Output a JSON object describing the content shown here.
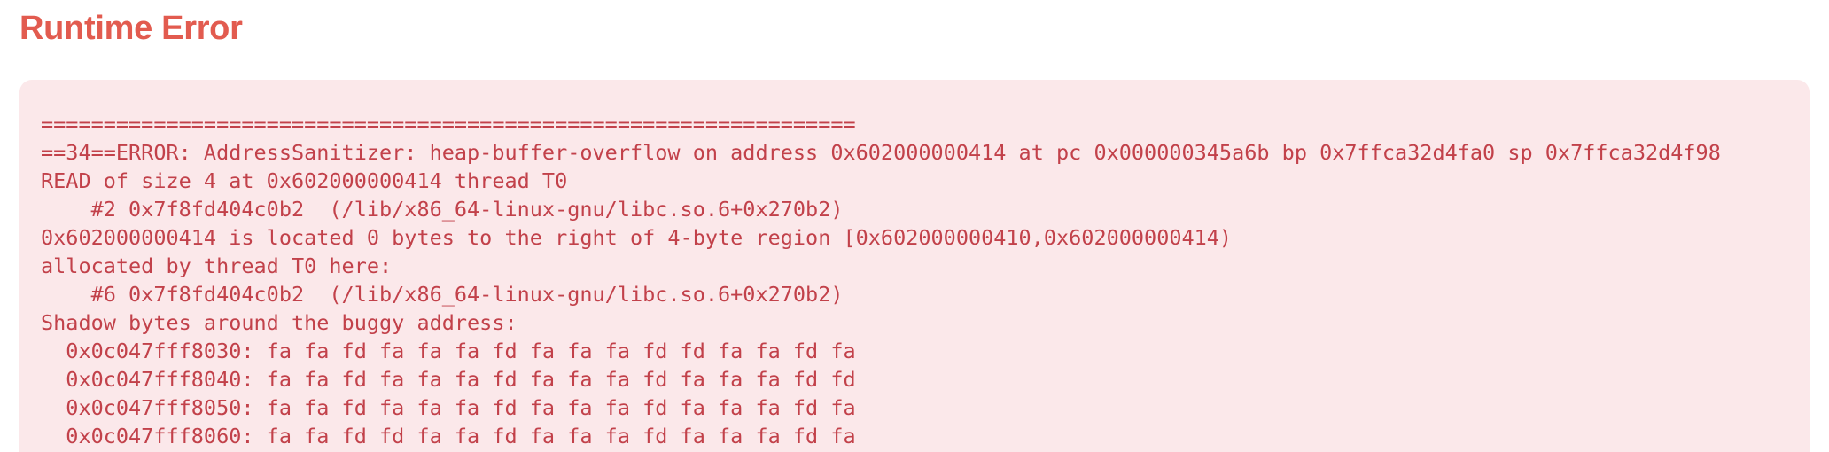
{
  "header": {
    "title": "Runtime Error"
  },
  "error": {
    "lines": [
      "=================================================================",
      "==34==ERROR: AddressSanitizer: heap-buffer-overflow on address 0x602000000414 at pc 0x000000345a6b bp 0x7ffca32d4fa0 sp 0x7ffca32d4f98",
      "READ of size 4 at 0x602000000414 thread T0",
      "    #2 0x7f8fd404c0b2  (/lib/x86_64-linux-gnu/libc.so.6+0x270b2)",
      "0x602000000414 is located 0 bytes to the right of 4-byte region [0x602000000410,0x602000000414)",
      "allocated by thread T0 here:",
      "    #6 0x7f8fd404c0b2  (/lib/x86_64-linux-gnu/libc.so.6+0x270b2)",
      "Shadow bytes around the buggy address:",
      "  0x0c047fff8030: fa fa fd fa fa fa fd fa fa fa fd fd fa fa fd fa",
      "  0x0c047fff8040: fa fa fd fa fa fa fd fa fa fa fd fa fa fa fd fd",
      "  0x0c047fff8050: fa fa fd fa fa fa fd fa fa fa fd fa fa fa fd fa",
      "  0x0c047fff8060: fa fa fd fd fa fa fd fa fa fa fd fa fa fa fd fa"
    ]
  },
  "colors": {
    "title": "#e25b4f",
    "box_background": "#fbe8ea",
    "error_text": "#c2414a"
  }
}
